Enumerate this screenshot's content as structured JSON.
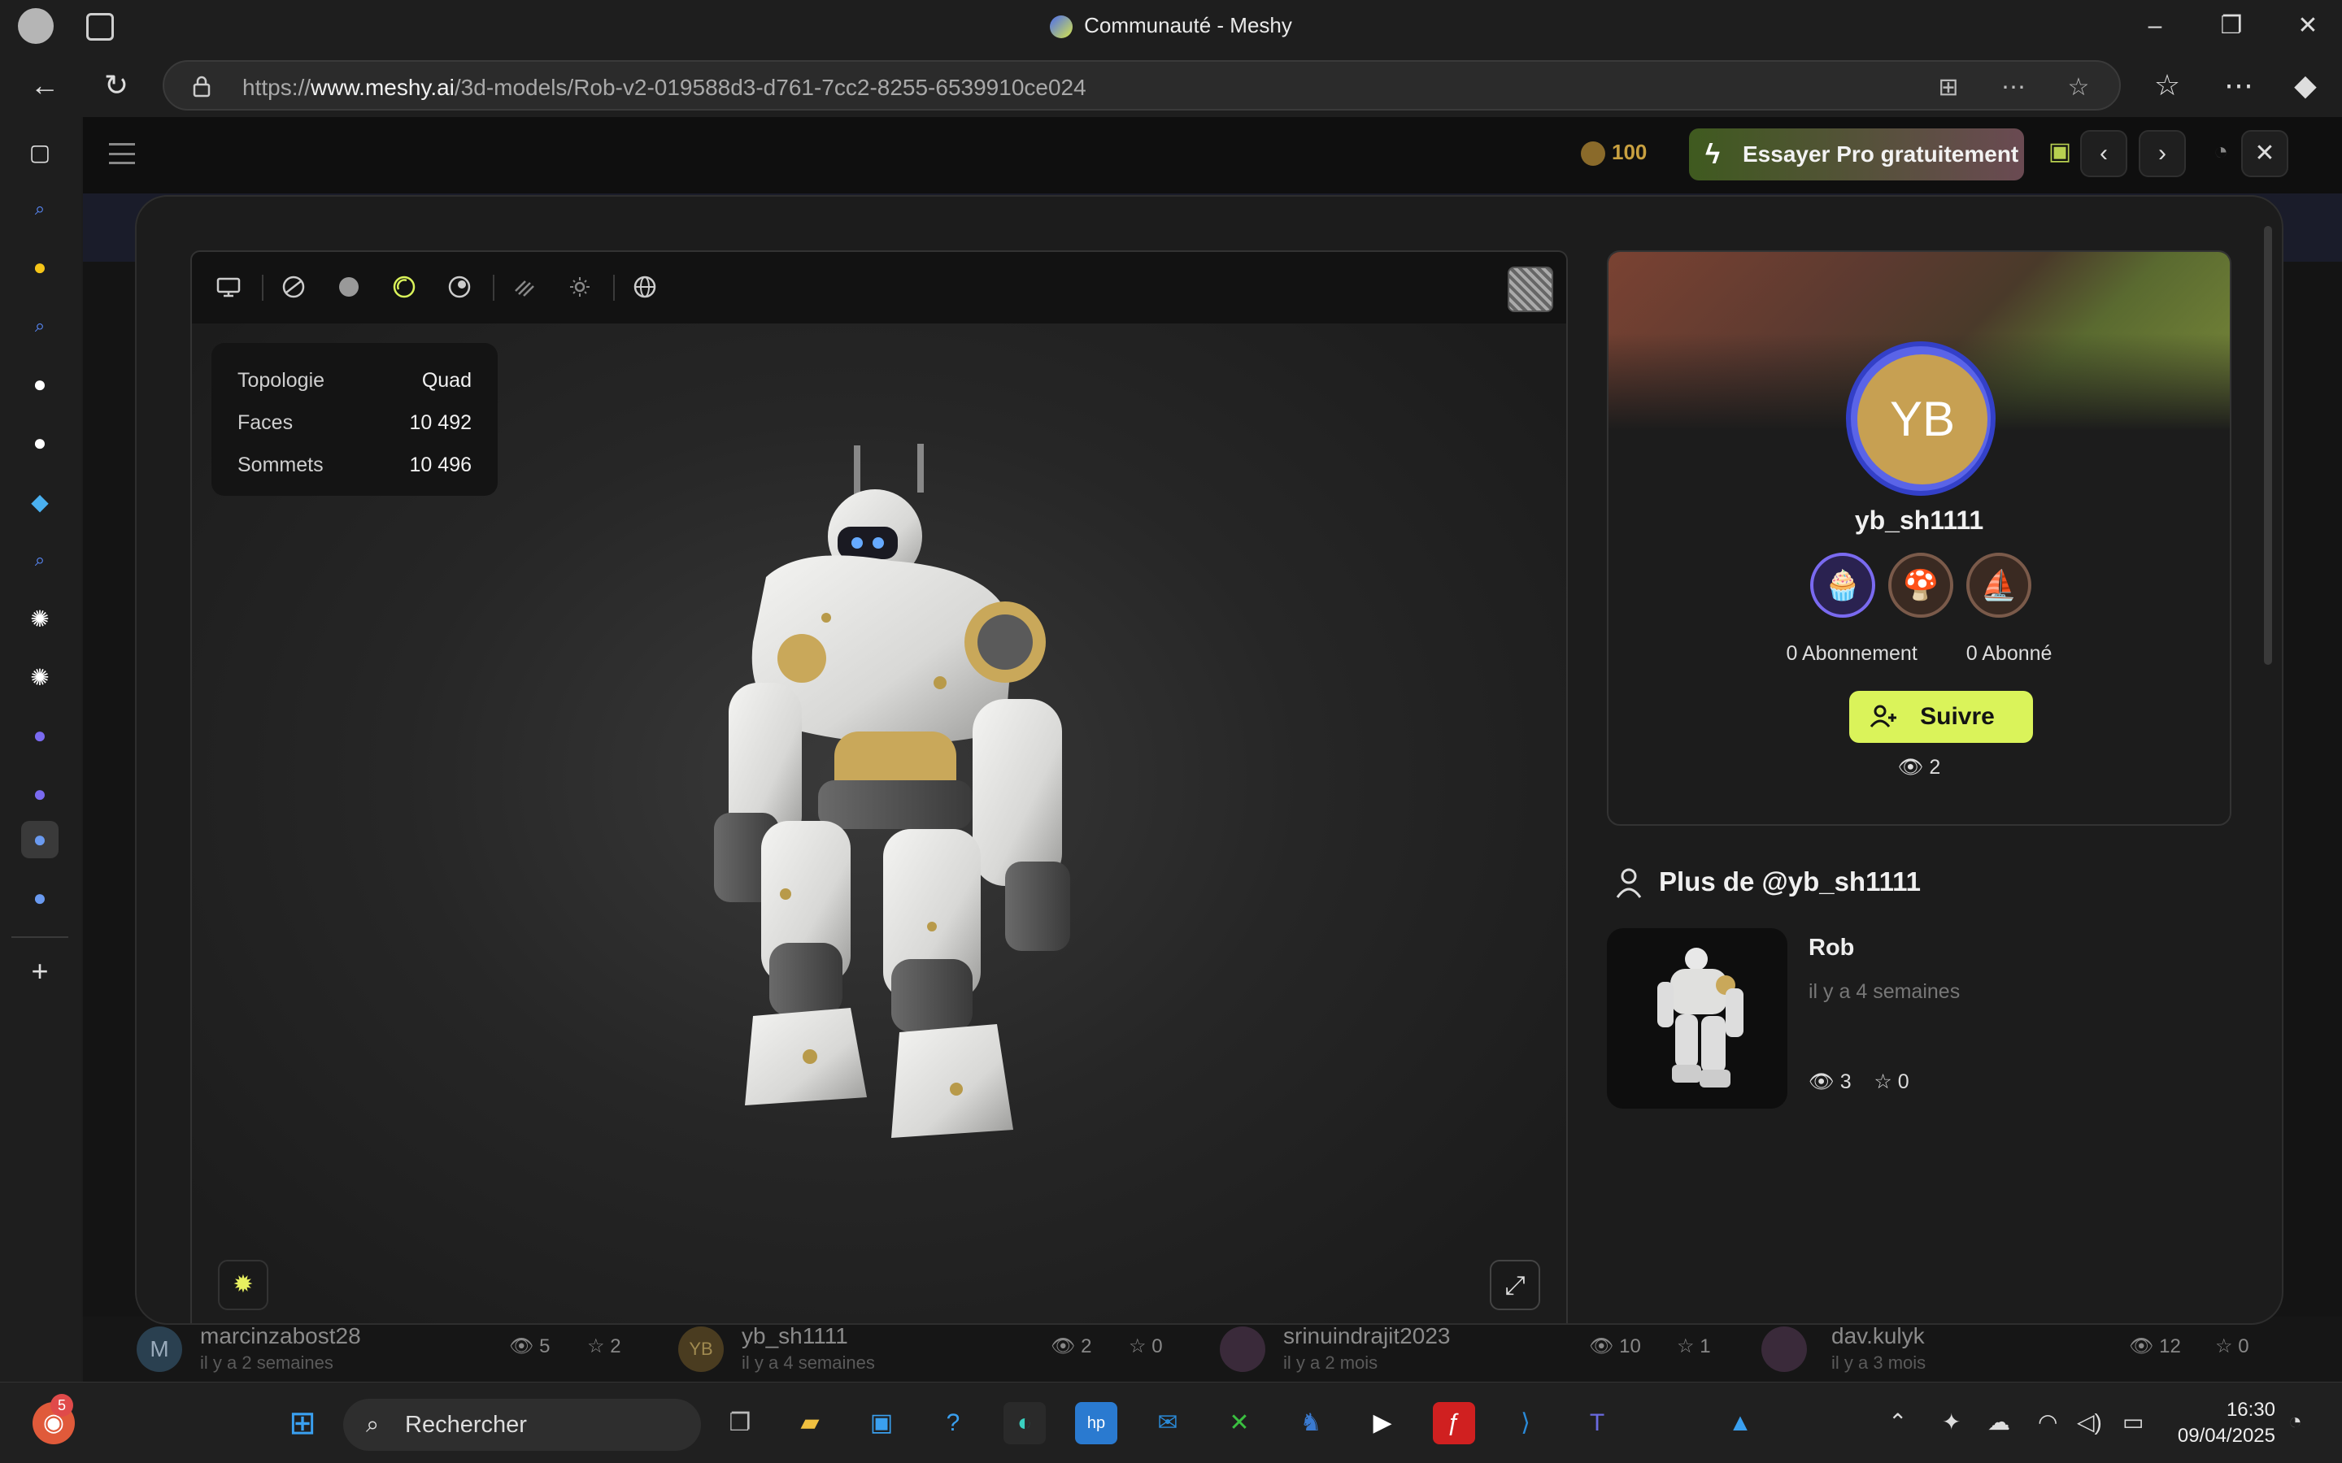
{
  "window": {
    "title": "Communauté - Meshy"
  },
  "address": {
    "url_prefix": "https://",
    "url_domain": "www.meshy.ai",
    "url_path": "/3d-models/Rob-v2-019588d3-d761-7cc2-8255-6539910ce024"
  },
  "topnav": {
    "credits": "100",
    "try_pro": "Essayer Pro gratuitement"
  },
  "stats": {
    "rows": [
      {
        "label": "Topologie",
        "value": "Quad"
      },
      {
        "label": "Faces",
        "value": "10 492"
      },
      {
        "label": "Sommets",
        "value": "10 496"
      }
    ]
  },
  "profile": {
    "initials": "YB",
    "username": "yb_sh1111",
    "following": "0 Abonnement",
    "followers": "0 Abonné",
    "follow_label": "Suivre",
    "views": "2"
  },
  "more": {
    "title": "Plus de @yb_sh1111",
    "card": {
      "title": "Rob",
      "time": "il y a 4 semaines",
      "views": "3",
      "stars": "0"
    }
  },
  "bottom_strip": [
    {
      "user": "marcinzabost28",
      "sub": "il y a 2 semaines",
      "views": "5",
      "stars": "2",
      "avatar": "M"
    },
    {
      "user": "yb_sh1111",
      "sub": "il y a 4 semaines",
      "views": "2",
      "stars": "0",
      "avatar": "YB"
    },
    {
      "user": "srinuindrajit2023",
      "sub": "il y a 2 mois",
      "views": "10",
      "stars": "1",
      "avatar": ""
    },
    {
      "user": "dav.kulyk",
      "sub": "il y a 3 mois",
      "views": "12",
      "stars": "0",
      "avatar": ""
    }
  ],
  "taskbar": {
    "search_placeholder": "Rechercher",
    "badge_count": "5",
    "time": "16:30",
    "date": "09/04/2025"
  },
  "colors": {
    "accent_lime": "#daf35a",
    "avatar_gold": "#c7a052",
    "avatar_ring": "#5a64e8"
  }
}
